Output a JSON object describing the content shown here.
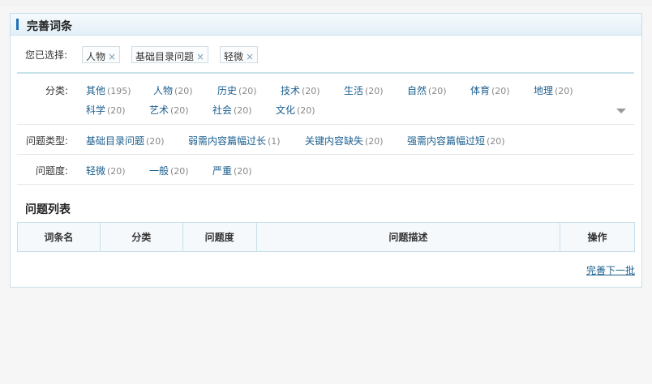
{
  "panel": {
    "title": "完善词条"
  },
  "selected": {
    "label": "您已选择:",
    "chips": [
      "人物",
      "基础目录问题",
      "轻微"
    ],
    "remove_glyph": "×"
  },
  "filters": {
    "category": {
      "label": "分类:",
      "options": [
        {
          "name": "其他",
          "count": "(195)"
        },
        {
          "name": "人物",
          "count": "(20)"
        },
        {
          "name": "历史",
          "count": "(20)"
        },
        {
          "name": "技术",
          "count": "(20)"
        },
        {
          "name": "生活",
          "count": "(20)"
        },
        {
          "name": "自然",
          "count": "(20)"
        },
        {
          "name": "体育",
          "count": "(20)"
        },
        {
          "name": "地理",
          "count": "(20)"
        },
        {
          "name": "科学",
          "count": "(20)"
        },
        {
          "name": "艺术",
          "count": "(20)"
        },
        {
          "name": "社会",
          "count": "(20)"
        },
        {
          "name": "文化",
          "count": "(20)"
        }
      ]
    },
    "type": {
      "label": "问题类型:",
      "options": [
        {
          "name": "基础目录问题",
          "count": "(20)"
        },
        {
          "name": "弱需内容篇幅过长",
          "count": "(1)"
        },
        {
          "name": "关键内容缺失",
          "count": "(20)"
        },
        {
          "name": "强需内容篇幅过短",
          "count": "(20)"
        }
      ]
    },
    "severity": {
      "label": "问题度:",
      "options": [
        {
          "name": "轻微",
          "count": "(20)"
        },
        {
          "name": "一般",
          "count": "(20)"
        },
        {
          "name": "严重",
          "count": "(20)"
        }
      ]
    }
  },
  "list": {
    "title": "问题列表",
    "columns": [
      "词条名",
      "分类",
      "问题度",
      "问题描述",
      "操作"
    ],
    "next_link": "完善下一批"
  },
  "icons": {
    "expand": "chevron-down-icon"
  }
}
